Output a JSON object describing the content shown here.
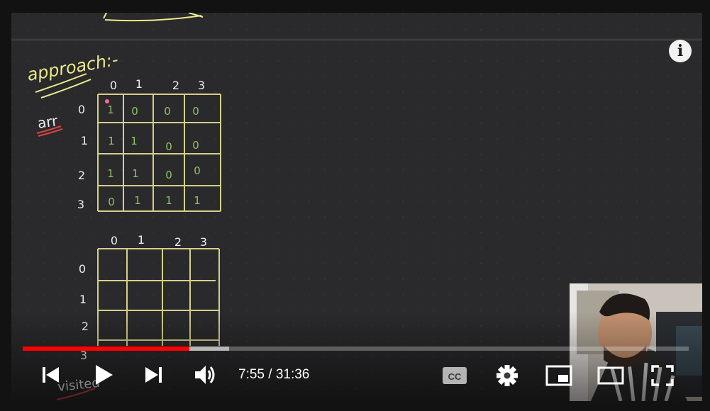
{
  "player": {
    "time": {
      "current": "7:55",
      "separator": " / ",
      "duration": "31:36"
    },
    "progress": {
      "played_fraction": 0.25,
      "buffered_fraction": 0.31
    },
    "info_glyph": "i",
    "controls": [
      {
        "name": "previous-button",
        "icon": "skip-previous-icon"
      },
      {
        "name": "play-button",
        "icon": "play-icon"
      },
      {
        "name": "next-button",
        "icon": "skip-next-icon"
      },
      {
        "name": "volume-button",
        "icon": "volume-icon"
      },
      {
        "name": "captions-button",
        "icon": "cc-icon"
      },
      {
        "name": "settings-button",
        "icon": "gear-icon"
      },
      {
        "name": "miniplayer-button",
        "icon": "miniplayer-icon"
      },
      {
        "name": "theater-button",
        "icon": "theater-icon"
      },
      {
        "name": "fullscreen-button",
        "icon": "fullscreen-icon"
      }
    ],
    "captions_label": "CC"
  },
  "video": {
    "heading": "approach:-",
    "array_label": "arr",
    "bottom_label": "visited",
    "grid_top": {
      "col_headers": [
        "0",
        "1",
        "2",
        "3"
      ],
      "row_headers": [
        "0",
        "1",
        "2",
        "3"
      ],
      "cells": [
        [
          "1",
          "0",
          "0",
          "0"
        ],
        [
          "1",
          "1",
          "0",
          "0"
        ],
        [
          "1",
          "1",
          "0",
          "0"
        ],
        [
          "0",
          "1",
          "1",
          "1"
        ]
      ]
    },
    "grid_bottom": {
      "col_headers": [
        "0",
        "1",
        "2",
        "3"
      ],
      "row_headers": [
        "0",
        "1",
        "2",
        "3"
      ]
    },
    "colors": {
      "board": "#2a292b",
      "grid_line": "#d4d08a",
      "cell_green": "#8fc466",
      "chalk": "#ededed",
      "heading": "#ecea8a",
      "underline": "#d9443f",
      "progress": "#ff0000"
    }
  }
}
